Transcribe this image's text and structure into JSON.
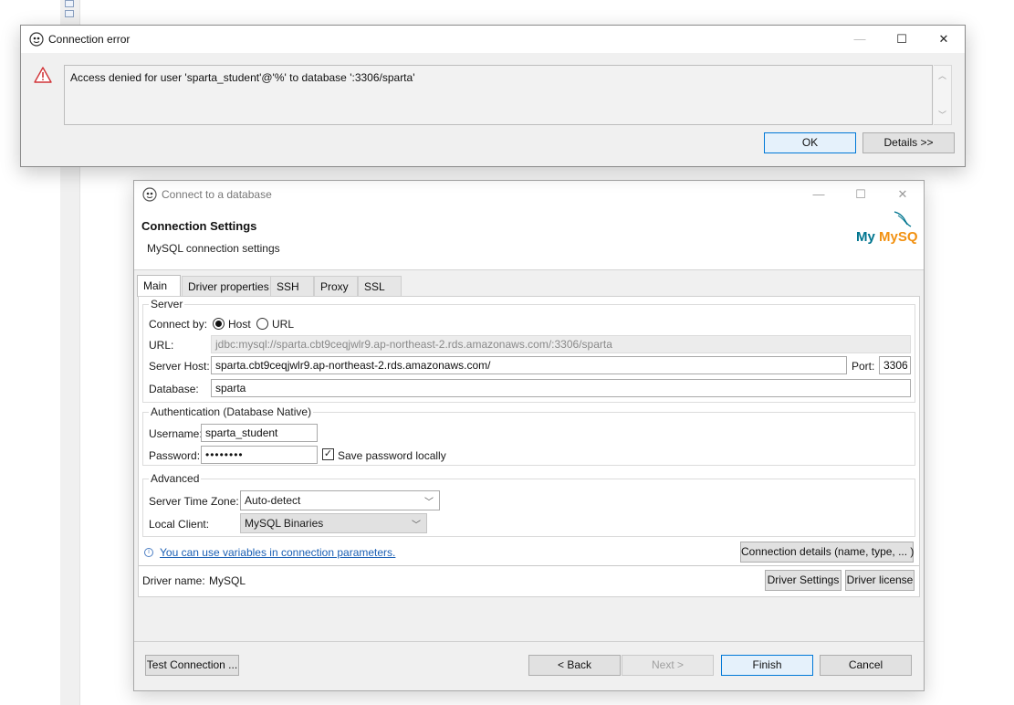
{
  "error_dialog": {
    "title": "Connection error",
    "message": "Access denied for user 'sparta_student'@'%' to database ':3306/sparta'",
    "ok_label": "OK",
    "details_label": "Details >>",
    "icons": [
      "dbeaver-icon",
      "warning-icon"
    ]
  },
  "dialog": {
    "title": "Connect to a database",
    "header_title": "Connection Settings",
    "header_subtitle": "MySQL connection settings",
    "logo_text": "MySQL",
    "tabs": [
      "Main",
      "Driver properties",
      "SSH",
      "Proxy",
      "SSL"
    ],
    "server": {
      "legend": "Server",
      "connect_by_label": "Connect by:",
      "host_option": "Host",
      "url_option": "URL",
      "selected": "Host",
      "url_label": "URL:",
      "url_value": "jdbc:mysql://sparta.cbt9ceqjwlr9.ap-northeast-2.rds.amazonaws.com/:3306/sparta",
      "host_label": "Server Host:",
      "host_value": "sparta.cbt9ceqjwlr9.ap-northeast-2.rds.amazonaws.com/",
      "port_label": "Port:",
      "port_value": "3306",
      "database_label": "Database:",
      "database_value": "sparta"
    },
    "auth": {
      "legend": "Authentication (Database Native)",
      "username_label": "Username:",
      "username_value": "sparta_student",
      "password_label": "Password:",
      "password_value": "••••••••",
      "save_password_label": "Save password locally",
      "save_password_checked": true
    },
    "advanced": {
      "legend": "Advanced",
      "timezone_label": "Server Time Zone:",
      "timezone_value": "Auto-detect",
      "local_client_label": "Local Client:",
      "local_client_value": "MySQL Binaries"
    },
    "variables_link": "You can use variables in connection parameters.",
    "connection_details_button": "Connection details (name, type, ... )",
    "driver_name_label": "Driver name:",
    "driver_name_value": "MySQL",
    "driver_settings_button": "Driver Settings",
    "driver_license_button": "Driver license",
    "buttons": {
      "test_connection": "Test Connection ...",
      "back": "< Back",
      "next": "Next >",
      "finish": "Finish",
      "cancel": "Cancel"
    }
  },
  "colors": {
    "link": "#1a5fb4",
    "default_button_border": "#0078d7",
    "warning": "#d13438",
    "mysql_blue": "#00758f",
    "mysql_orange": "#f29111"
  }
}
